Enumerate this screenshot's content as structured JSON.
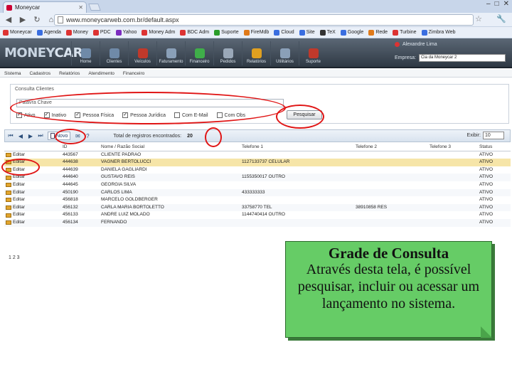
{
  "browser": {
    "tab_title": "Moneycar",
    "url": "www.moneycarweb.com.br/default.aspx",
    "window_controls": [
      "–",
      "□",
      "✕"
    ]
  },
  "bookmarks": [
    {
      "label": "Moneycar",
      "color": "#d33"
    },
    {
      "label": "Agenda",
      "color": "#3a6ee0"
    },
    {
      "label": "Money",
      "color": "#d33"
    },
    {
      "label": "PDC",
      "color": "#d33"
    },
    {
      "label": "Yahoo",
      "color": "#7b2cbf"
    },
    {
      "label": "Money Adm",
      "color": "#d33"
    },
    {
      "label": "BDC Adm",
      "color": "#d33"
    },
    {
      "label": "Suporte",
      "color": "#2a9d2a"
    },
    {
      "label": "FireMdb",
      "color": "#e07a1a"
    },
    {
      "label": "Cloud",
      "color": "#3a6ee0"
    },
    {
      "label": "Site",
      "color": "#3a6ee0"
    },
    {
      "label": "TeX",
      "color": "#333"
    },
    {
      "label": "Google",
      "color": "#3a6ee0"
    },
    {
      "label": "Rede",
      "color": "#e07a1a"
    },
    {
      "label": "Turbine",
      "color": "#d33"
    },
    {
      "label": "Zimbra Web",
      "color": "#3a6ee0"
    }
  ],
  "app": {
    "logo_a": "MONEY",
    "logo_b": "CAR",
    "nav": [
      {
        "label": "Home",
        "color": "#6f8aa8"
      },
      {
        "label": "Clientes",
        "color": "#6f8aa8"
      },
      {
        "label": "Veículos",
        "color": "#c0392b"
      },
      {
        "label": "Faturamento",
        "color": "#8aa0b8"
      },
      {
        "label": "Financeiro",
        "color": "#3fae49"
      },
      {
        "label": "Pedidos",
        "color": "#9aa8b8"
      },
      {
        "label": "Relatórios",
        "color": "#e0a020"
      },
      {
        "label": "Utilitários",
        "color": "#8aa0b8"
      },
      {
        "label": "Suporte",
        "color": "#c0392b"
      }
    ],
    "user": "Alexandre Lima",
    "empresa_label": "Empresa:",
    "empresa_value": "Cia da Moneycar 2"
  },
  "menubar": [
    "Sistema",
    "Cadastros",
    "Relatórios",
    "Atendimento",
    "Financeiro"
  ],
  "filter": {
    "title": "Consulta Clientes",
    "keyword_placeholder": "Palavra Chave",
    "checkboxes": [
      {
        "label": "Ativo",
        "checked": true
      },
      {
        "label": "Inativo",
        "checked": true
      },
      {
        "label": "Pessoa Física",
        "checked": true
      },
      {
        "label": "Pessoa Jurídica",
        "checked": true
      },
      {
        "label": "Com E-Mail",
        "checked": false
      },
      {
        "label": "Com Obs",
        "checked": false
      }
    ],
    "search_button": "Pesquisar"
  },
  "gridbar": {
    "novo_button": "Novo",
    "total_label": "Total de registros encontrados:",
    "total_count": "20",
    "exibir_label": "Exibir:",
    "exibir_value": "10"
  },
  "grid": {
    "columns": [
      "",
      "ID",
      "Nome / Razão Social",
      "Telefone 1",
      "Telefone 2",
      "Telefone 3",
      "Status"
    ],
    "rows": [
      {
        "action": "Editar",
        "id": "443567",
        "name": "CLIENTE PADRAO",
        "tel1": "",
        "tel2": "",
        "tel3": "",
        "status": "ATIVO",
        "selected": false
      },
      {
        "action": "Editar",
        "id": "444638",
        "name": "VAGNER BERTOLUCCI",
        "tel1": "1127133737 CELULAR",
        "tel2": "",
        "tel3": "",
        "status": "ATIVO",
        "selected": true
      },
      {
        "action": "Editar",
        "id": "444639",
        "name": "DANIELA GAGLIARDI",
        "tel1": "",
        "tel2": "",
        "tel3": "",
        "status": "ATIVO",
        "selected": false
      },
      {
        "action": "Editar",
        "id": "444640",
        "name": "GUSTAVO REIS",
        "tel1": "1155350017 OUTRO",
        "tel2": "",
        "tel3": "",
        "status": "ATIVO",
        "selected": false
      },
      {
        "action": "Editar",
        "id": "444645",
        "name": "GEORGIA SILVA",
        "tel1": "",
        "tel2": "",
        "tel3": "",
        "status": "ATIVO",
        "selected": false
      },
      {
        "action": "Editar",
        "id": "450190",
        "name": "CARLOS LIMA",
        "tel1": "433333333",
        "tel2": "",
        "tel3": "",
        "status": "ATIVO",
        "selected": false
      },
      {
        "action": "Editar",
        "id": "456818",
        "name": "MARCELO GOLDBERGER",
        "tel1": "",
        "tel2": "",
        "tel3": "",
        "status": "ATIVO",
        "selected": false
      },
      {
        "action": "Editar",
        "id": "456132",
        "name": "CARLA MARIA BORTOLETTO",
        "tel1": "33758770 TEL",
        "tel2": "38910858 RES",
        "tel3": "",
        "status": "ATIVO",
        "selected": false
      },
      {
        "action": "Editar",
        "id": "456133",
        "name": "ANDRE LUIZ MOLADO",
        "tel1": "1144740414 OUTRO",
        "tel2": "",
        "tel3": "",
        "status": "ATIVO",
        "selected": false
      },
      {
        "action": "Editar",
        "id": "456134",
        "name": "FERNANDO",
        "tel1": "",
        "tel2": "",
        "tel3": "",
        "status": "ATIVO",
        "selected": false
      }
    ],
    "pager": "1 2 3"
  },
  "callout": {
    "title": "Grade de Consulta",
    "body": "Através desta tela, é possível pesquisar, incluir ou acessar um lançamento no sistema.",
    "color": "#66cc66"
  },
  "annotation_color": "#e01515"
}
